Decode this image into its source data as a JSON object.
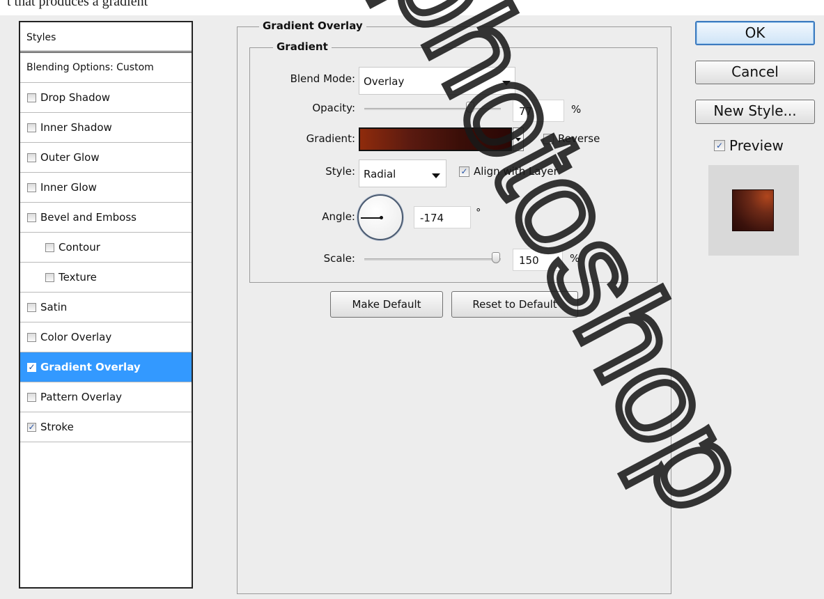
{
  "page_header_fragment": "t that produces a gradient",
  "styles_panel": {
    "title": "Styles",
    "blending_options": "Blending Options: Custom",
    "items": [
      {
        "label": "Drop Shadow",
        "checked": false
      },
      {
        "label": "Inner Shadow",
        "checked": false
      },
      {
        "label": "Outer Glow",
        "checked": false
      },
      {
        "label": "Inner Glow",
        "checked": false
      },
      {
        "label": "Bevel and Emboss",
        "checked": false
      },
      {
        "label": "Contour",
        "checked": false
      },
      {
        "label": "Texture",
        "checked": false
      },
      {
        "label": "Satin",
        "checked": false
      },
      {
        "label": "Color Overlay",
        "checked": false
      },
      {
        "label": "Gradient Overlay",
        "checked": true,
        "selected": true
      },
      {
        "label": "Pattern Overlay",
        "checked": false
      },
      {
        "label": "Stroke",
        "checked": true
      }
    ]
  },
  "gradient_overlay": {
    "section_title": "Gradient Overlay",
    "group_title": "Gradient",
    "blend_mode": {
      "label": "Blend Mode:",
      "value": "Overlay"
    },
    "opacity": {
      "label": "Opacity:",
      "value": "77",
      "unit": "%",
      "fraction": 0.77
    },
    "gradient": {
      "label": "Gradient:",
      "stops": [
        "#8f2b0c",
        "#5a1a10",
        "#3a0e08",
        "#2b0705"
      ]
    },
    "reverse": {
      "label": "Reverse",
      "checked": false
    },
    "style": {
      "label": "Style:",
      "value": "Radial"
    },
    "align_with_layer": {
      "label": "Align with Layer",
      "checked": true
    },
    "angle": {
      "label": "Angle:",
      "value": "-174",
      "unit": "°"
    },
    "scale": {
      "label": "Scale:",
      "value": "150",
      "unit": "%",
      "fraction": 1.0
    },
    "make_default": "Make Default",
    "reset_to_default": "Reset to Default"
  },
  "dialog_buttons": {
    "ok": "OK",
    "cancel": "Cancel",
    "new_style": "New Style...",
    "preview": {
      "label": "Preview",
      "checked": true
    }
  },
  "watermark": "photoshop",
  "colors": {
    "selection": "#3399ff",
    "preview_swatch": "#5a1d10"
  }
}
